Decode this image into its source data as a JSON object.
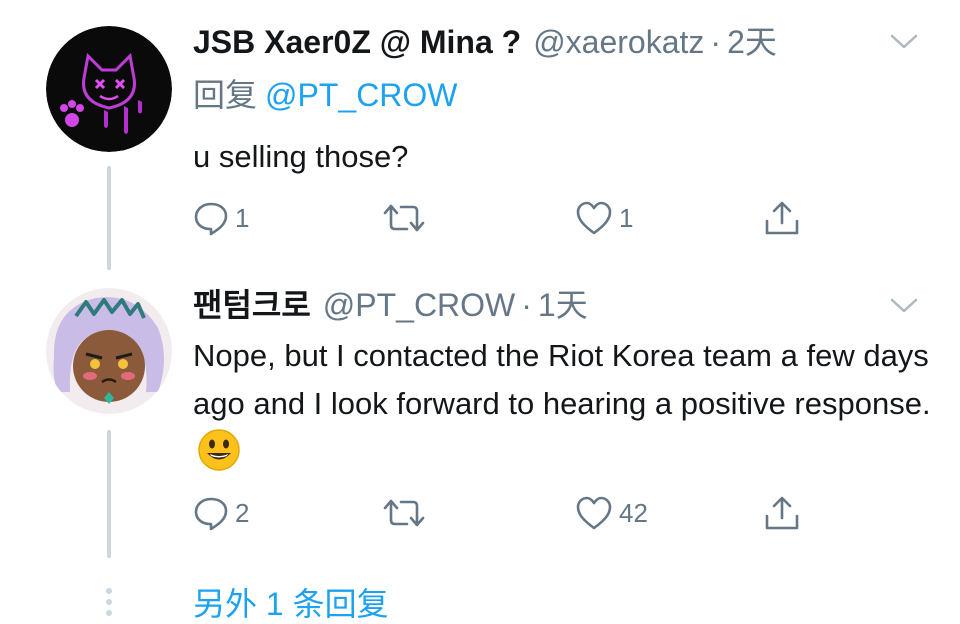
{
  "tweet1": {
    "display_name": "JSB Xaer0Z @ Mina ?",
    "handle": "@xaerokatz",
    "dot": "·",
    "time": "2天",
    "reply_prefix": "回复",
    "reply_to": "@PT_CROW",
    "text": "u selling those?",
    "reply_count": "1",
    "retweet_count": "",
    "like_count": "1"
  },
  "tweet2": {
    "display_name": "팬텀크로",
    "handle": "@PT_CROW",
    "dot": "·",
    "time": "1天",
    "text": "Nope, but I contacted the Riot Korea team a few days ago and I look forward to hearing a positive response.",
    "reply_count": "2",
    "retweet_count": "",
    "like_count": "42"
  },
  "more_replies": "另外 1 条回复",
  "colors": {
    "text": "#14171a",
    "muted": "#657786",
    "link": "#1da1f2",
    "thread_line": "#ccd6dd"
  },
  "icons": {
    "reply": "speech-bubble-icon",
    "retweet": "retweet-arrows-icon",
    "like": "heart-icon",
    "share": "share-upload-icon",
    "menu": "chevron-down-icon",
    "emoji": "smiling-face-emoji"
  }
}
